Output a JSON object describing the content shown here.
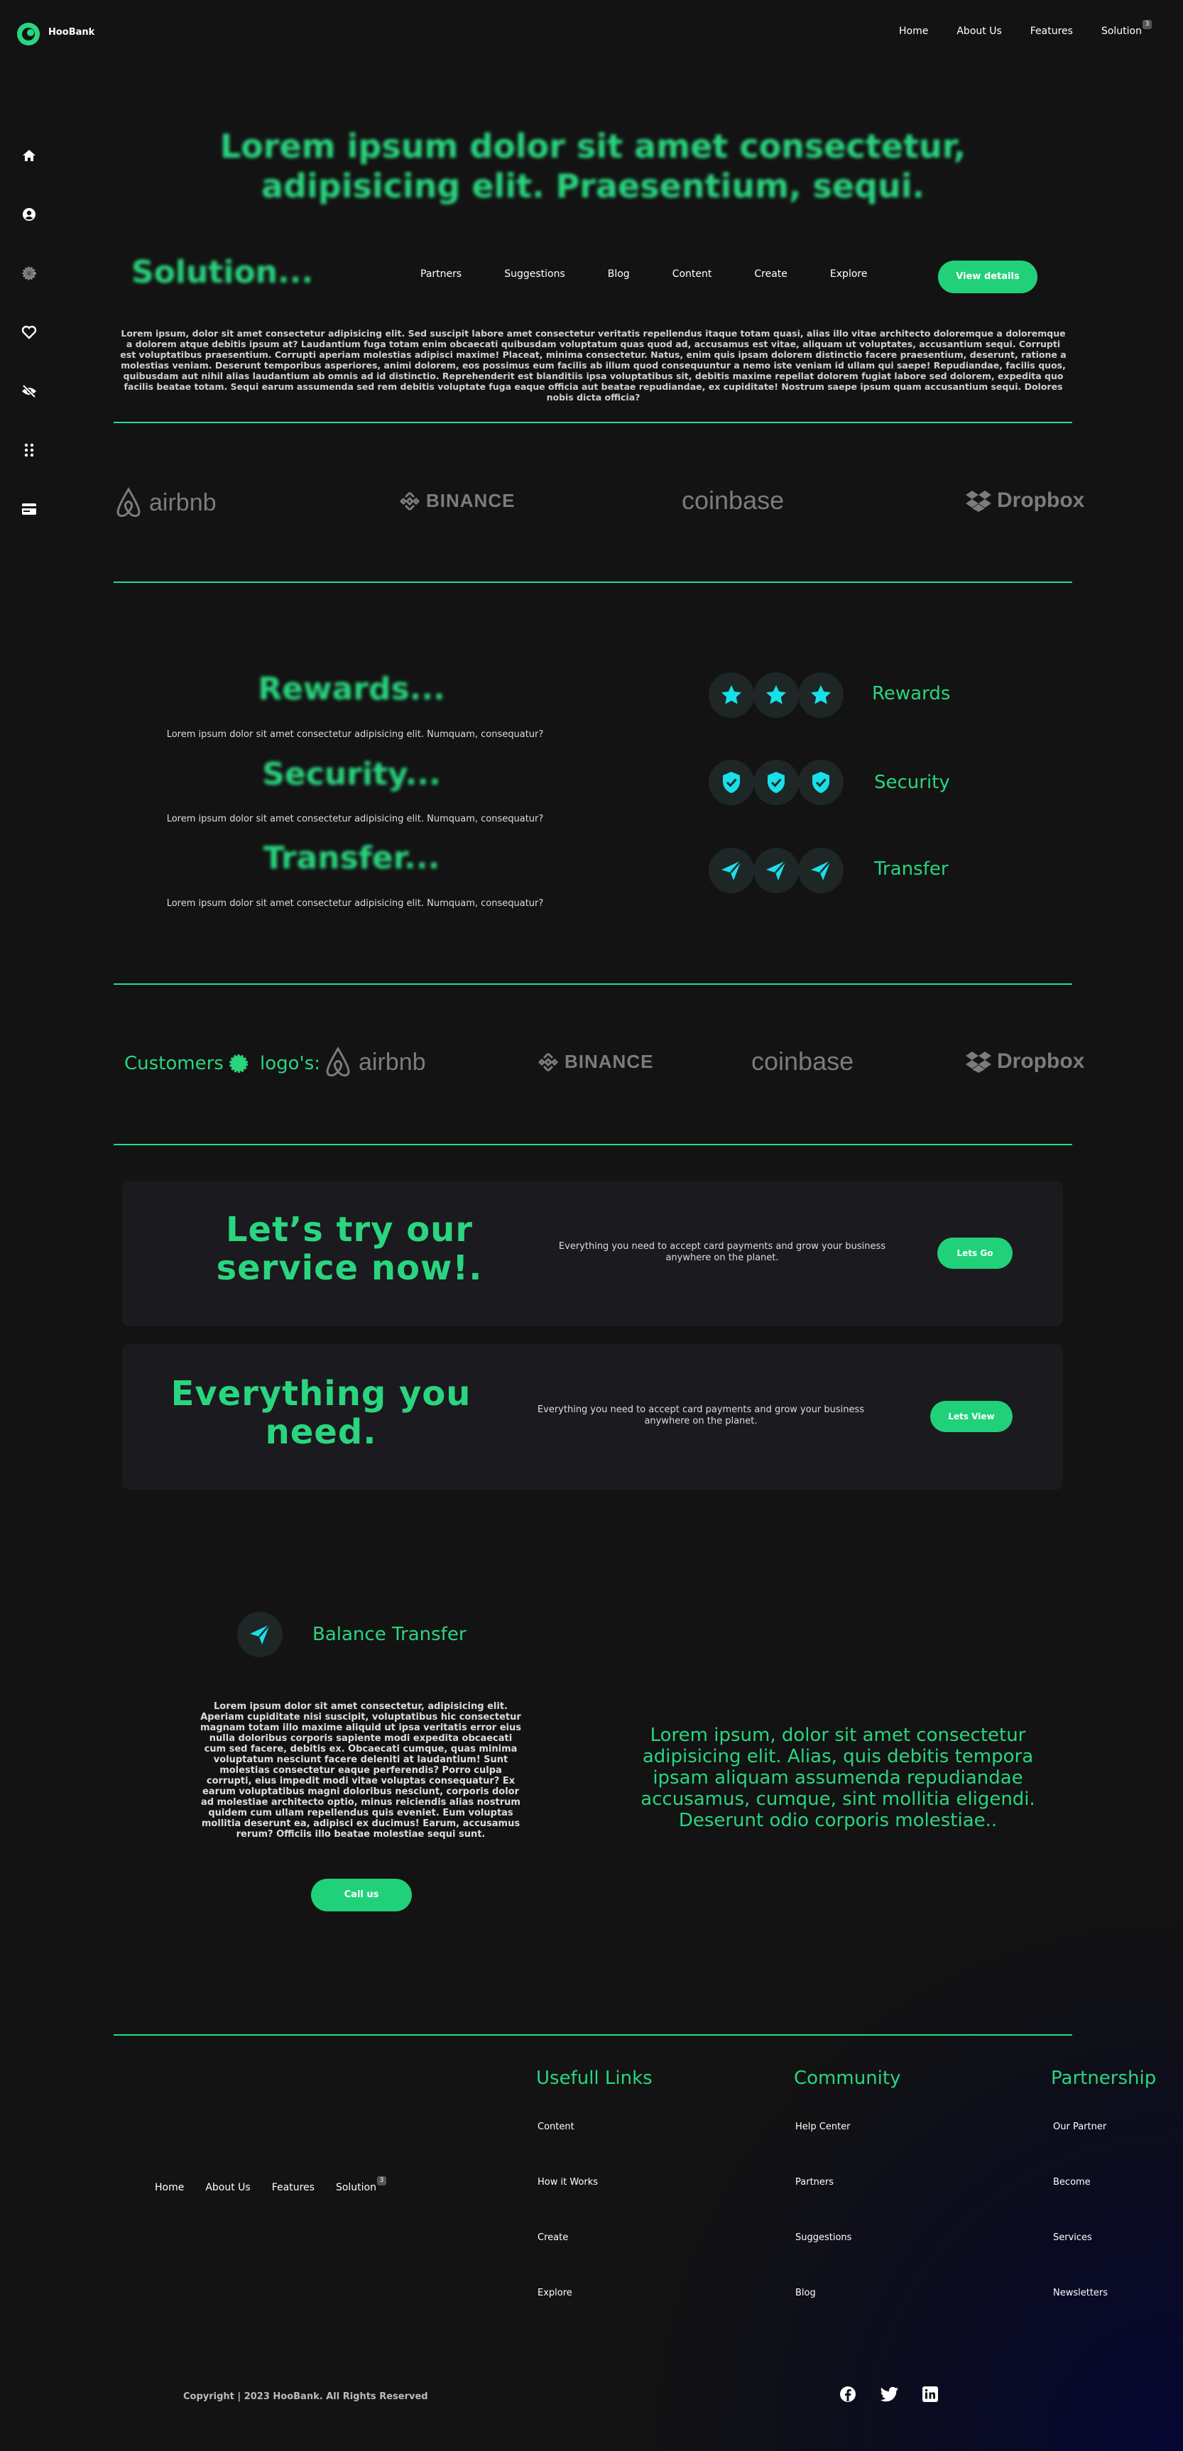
{
  "brand": {
    "name": "HooBank"
  },
  "topnav": {
    "home": "Home",
    "about": "About Us",
    "features": "Features",
    "solution": "Solution",
    "badge": "3"
  },
  "sidebar": {
    "icons": [
      "home-icon",
      "user-icon",
      "gear-icon",
      "heart-icon",
      "eye-off-icon",
      "apps-icon",
      "card-icon"
    ]
  },
  "hero": {
    "title": "Lorem ipsum dolor sit amet consectetur, adipisicing elit. Praesentium, sequi."
  },
  "solution": {
    "title": "Solution...",
    "nav": [
      "Partners",
      "Suggestions",
      "Blog",
      "Content",
      "Create",
      "Explore"
    ],
    "button": "View details",
    "text": "Lorem ipsum, dolor sit amet consectetur adipisicing elit. Sed suscipit labore amet consectetur veritatis repellendus itaque totam quasi, alias illo vitae architecto doloremque a doloremque a dolorem atque debitis ipsum at? Laudantium fuga totam enim obcaecati quibusdam voluptatum quas quod ad, accusamus est vitae, aliquam ut voluptates, accusantium sequi. Corrupti est voluptatibus praesentium. Corrupti aperiam molestias adipisci maxime! Placeat, minima consectetur. Natus, enim quis ipsam dolorem distinctio facere praesentium, deserunt, ratione a molestias veniam. Deserunt temporibus asperiores, animi dolorem, eos possimus eum facilis ab illum quod consequuntur a nemo iste veniam id ullam qui saepe! Repudiandae, facilis quos, quibusdam aut nihil alias laudantium ab omnis ad id distinctio. Reprehenderit est blanditiis ipsa voluptatibus sit, debitis maxime repellat dolorem fugiat labore sed dolorem, expedita quo facilis beatae totam. Sequi earum assumenda sed rem debitis voluptate fuga eaque officia aut beatae repudiandae, ex cupiditate! Nostrum saepe ipsum quam accusantium sequi. Dolores nobis dicta officia?"
  },
  "logos": {
    "airbnb": "airbnb",
    "binance": "BINANCE",
    "coinbase": "coinbase",
    "dropbox": "Dropbox"
  },
  "features": [
    {
      "title": "Rewards...",
      "desc": "Lorem ipsum dolor sit amet consectetur adipisicing elit. Numquam, consequatur?",
      "label": "Rewards",
      "icon": "star-icon"
    },
    {
      "title": "Security...",
      "desc": "Lorem ipsum dolor sit amet consectetur adipisicing elit. Numquam, consequatur?",
      "label": "Security",
      "icon": "shield-icon"
    },
    {
      "title": "Transfer...",
      "desc": "Lorem ipsum dolor sit amet consectetur adipisicing elit. Numquam, consequatur?",
      "label": "Transfer",
      "icon": "send-icon"
    }
  ],
  "customers": {
    "label1": "Customers",
    "label2": "logo's:"
  },
  "cta1": {
    "title": "Let’s try our service now!.",
    "text": "Everything you need to accept card payments and grow your business anywhere on the planet.",
    "button": "Lets Go"
  },
  "cta2": {
    "title": "Everything you need.",
    "text": "Everything you need to accept card payments and grow your business anywhere on the planet.",
    "button": "Lets View"
  },
  "balance": {
    "label": "Balance Transfer",
    "text": "Lorem ipsum dolor sit amet consectetur, adipisicing elit. Aperiam cupiditate nisi suscipit, voluptatibus hic consectetur magnam totam illo maxime aliquid ut ipsa veritatis error eius nulla doloribus corporis sapiente modi expedita obcaecati cum sed facere, debitis ex. Obcaecati cumque, quas minima voluptatum nesciunt facere deleniti at laudantium! Sunt molestias consectetur eaque perferendis? Porro culpa corrupti, eius impedit modi vitae voluptas consequatur? Ex earum voluptatibus magni doloribus nesciunt, corporis dolor ad molestiae architecto optio, minus reiciendis alias nostrum quidem cum ullam repellendus quis eveniet. Eum voluptas mollitia deserunt ea, adipisci ex ducimus! Earum, accusamus rerum? Officiis illo beatae molestiae sequi sunt.",
    "button": "Call us",
    "quote": "Lorem ipsum, dolor sit amet consectetur adipisicing elit. Alias, quis debitis tempora ipsam aliquam assumenda repudiandae accusamus, cumque, sint mollitia eligendi. Deserunt odio corporis molestiae.."
  },
  "footer": {
    "nav": {
      "home": "Home",
      "about": "About Us",
      "features": "Features",
      "solution": "Solution",
      "badge": "3"
    },
    "cols": [
      {
        "head": "Usefull Links",
        "links": [
          "Content",
          "How it Works",
          "Create",
          "Explore"
        ]
      },
      {
        "head": "Community",
        "links": [
          "Help Center",
          "Partners",
          "Suggestions",
          "Blog"
        ]
      },
      {
        "head": "Partnership",
        "links": [
          "Our Partner",
          "Become",
          "Services",
          "Newsletters"
        ]
      }
    ],
    "copyright": "Copyright | 2023 HooBank. All Rights Reserved",
    "social": [
      "facebook-icon",
      "twitter-icon",
      "linkedin-icon"
    ]
  },
  "colors": {
    "accent": "#2ad57f",
    "background": "#131313",
    "card": "#1b1a1f",
    "icon": "#17e0ea"
  }
}
